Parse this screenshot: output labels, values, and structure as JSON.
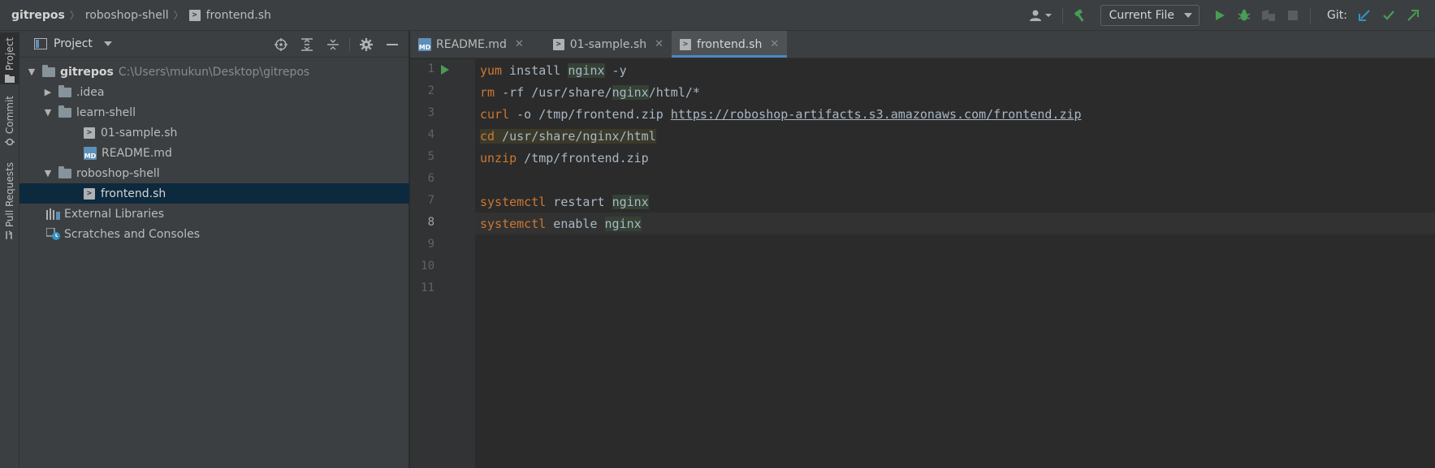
{
  "breadcrumb": {
    "root": "gitrepos",
    "folder": "roboshop-shell",
    "file": "frontend.sh"
  },
  "toolbar": {
    "run_config": "Current File",
    "git_label": "Git:"
  },
  "tool_stripe": {
    "project": "Project",
    "commit": "Commit",
    "pull_requests": "Pull Requests"
  },
  "project_panel": {
    "title": "Project",
    "tree": {
      "root_name": "gitrepos",
      "root_path": "C:\\Users\\mukun\\Desktop\\gitrepos",
      "idea": ".idea",
      "learn_shell": "learn-shell",
      "sample_sh": "01-sample.sh",
      "readme": "README.md",
      "roboshop_shell": "roboshop-shell",
      "frontend_sh": "frontend.sh",
      "external_libraries": "External Libraries",
      "scratches": "Scratches and Consoles"
    }
  },
  "editor": {
    "tabs": [
      {
        "label": "README.md"
      },
      {
        "label": "01-sample.sh"
      },
      {
        "label": "frontend.sh"
      }
    ],
    "line_numbers": [
      "1",
      "2",
      "3",
      "4",
      "5",
      "6",
      "7",
      "8",
      "9",
      "10",
      "11"
    ],
    "code": {
      "l1_cmd": "yum",
      "l1_a": " install ",
      "l1_pkg": "nginx",
      "l1_b": " -y",
      "l2_cmd": "rm",
      "l2_a": " -rf /usr/share/",
      "l2_pkg": "nginx",
      "l2_b": "/html/*",
      "l3_cmd": "curl",
      "l3_a": " -o /tmp/frontend.zip ",
      "l3_url": "https://roboshop-artifacts.s3.amazonaws.com/frontend.zip",
      "l4_cmd": "cd",
      "l4_a": " /usr/share/nginx/html",
      "l5_cmd": "unzip",
      "l5_a": " /tmp/frontend.zip",
      "l7_cmd": "systemctl",
      "l7_a": " restart ",
      "l7_pkg": "nginx",
      "l8_cmd": "systemctl",
      "l8_a": " enable ",
      "l8_pkg": "nginx"
    }
  },
  "icons": {
    "run": "play-icon",
    "debug": "bug-icon",
    "build": "hammer-icon",
    "user": "user-icon"
  },
  "colors": {
    "keyword": "#cc7832",
    "selection": "#0d293e",
    "run_green": "#499c54",
    "git_update": "#3592c4"
  }
}
